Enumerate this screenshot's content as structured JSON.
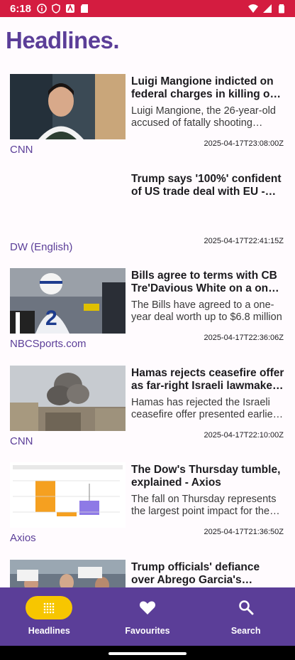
{
  "status": {
    "time": "6:18"
  },
  "page_title": "Headlines.",
  "articles": [
    {
      "title": "Luigi Mangione indicted on federal charges in killing of UnitedHealthcare CEO",
      "description": "Luigi Mangione, the 26-year-old accused of fatally shooting UnitedHealthcare CEO",
      "date": "2025-04-17T23:08:00Z",
      "source": "CNN"
    },
    {
      "title": "Trump says '100%' confident of US trade deal with EU - DW",
      "description": "",
      "date": "2025-04-17T22:41:15Z",
      "source": "DW (English)"
    },
    {
      "title": "Bills agree to terms with CB Tre'Davious White on a one-year deal",
      "description": "The Bills have agreed to a one-year deal worth up to $6.8 million",
      "date": "2025-04-17T22:36:06Z",
      "source": "NBCSports.com"
    },
    {
      "title": "Hamas rejects ceasefire offer as far-right Israeli lawmakers push",
      "description": "Hamas has rejected the Israeli ceasefire offer presented earlier this week",
      "date": "2025-04-17T22:10:00Z",
      "source": "CNN"
    },
    {
      "title": "The Dow's Thursday tumble, explained - Axios",
      "description": "The fall on Thursday represents the largest point impact for the Dow",
      "date": "2025-04-17T21:36:50Z",
      "source": "Axios"
    },
    {
      "title": "Trump officials' defiance over Abrego Garcia's deportation is...",
      "description": "",
      "date": "",
      "source": ""
    }
  ],
  "nav": {
    "headlines": "Headlines",
    "favourites": "Favourites",
    "search": "Search"
  },
  "colors": {
    "accent": "#5B3E98",
    "status_bar": "#D41C40",
    "active_pill": "#F7C600"
  }
}
